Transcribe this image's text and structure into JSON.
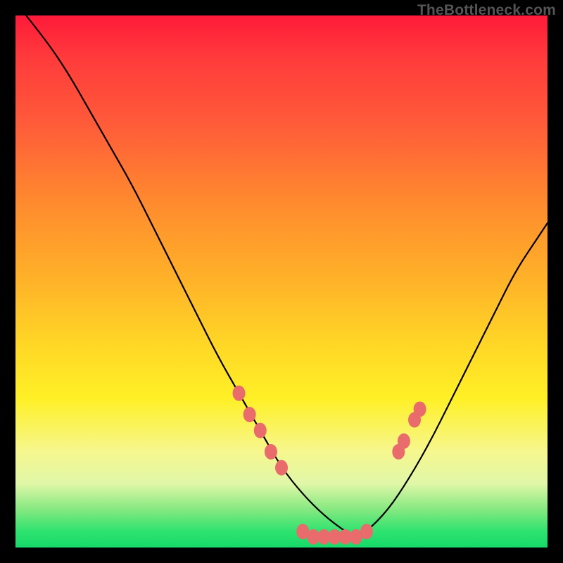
{
  "watermark": "TheBottleneck.com",
  "chart_data": {
    "type": "line",
    "title": "",
    "xlabel": "",
    "ylabel": "",
    "xlim": [
      0,
      100
    ],
    "ylim": [
      0,
      100
    ],
    "grid": false,
    "legend": false,
    "series": [
      {
        "name": "bottleneck-curve",
        "x": [
          2,
          6,
          10,
          14,
          18,
          22,
          26,
          30,
          34,
          38,
          42,
          46,
          50,
          54,
          58,
          62,
          64,
          66,
          70,
          74,
          78,
          82,
          86,
          90,
          94,
          98,
          100
        ],
        "y": [
          100,
          95,
          89,
          82,
          75,
          68,
          60,
          52,
          44,
          36,
          29,
          22,
          15,
          10,
          6,
          3,
          2,
          3,
          7,
          13,
          20,
          28,
          36,
          44,
          52,
          58,
          61
        ]
      }
    ],
    "markers": [
      {
        "x": 42,
        "y": 29
      },
      {
        "x": 44,
        "y": 25
      },
      {
        "x": 46,
        "y": 22
      },
      {
        "x": 48,
        "y": 18
      },
      {
        "x": 50,
        "y": 15
      },
      {
        "x": 54,
        "y": 3
      },
      {
        "x": 56,
        "y": 2
      },
      {
        "x": 58,
        "y": 2
      },
      {
        "x": 60,
        "y": 2
      },
      {
        "x": 62,
        "y": 2
      },
      {
        "x": 64,
        "y": 2
      },
      {
        "x": 66,
        "y": 3
      },
      {
        "x": 72,
        "y": 18
      },
      {
        "x": 73,
        "y": 20
      },
      {
        "x": 75,
        "y": 24
      },
      {
        "x": 76,
        "y": 26
      }
    ],
    "background_gradient": {
      "top": "#ff1a3a",
      "middle": "#ffd726",
      "bottom": "#16d96a"
    }
  }
}
